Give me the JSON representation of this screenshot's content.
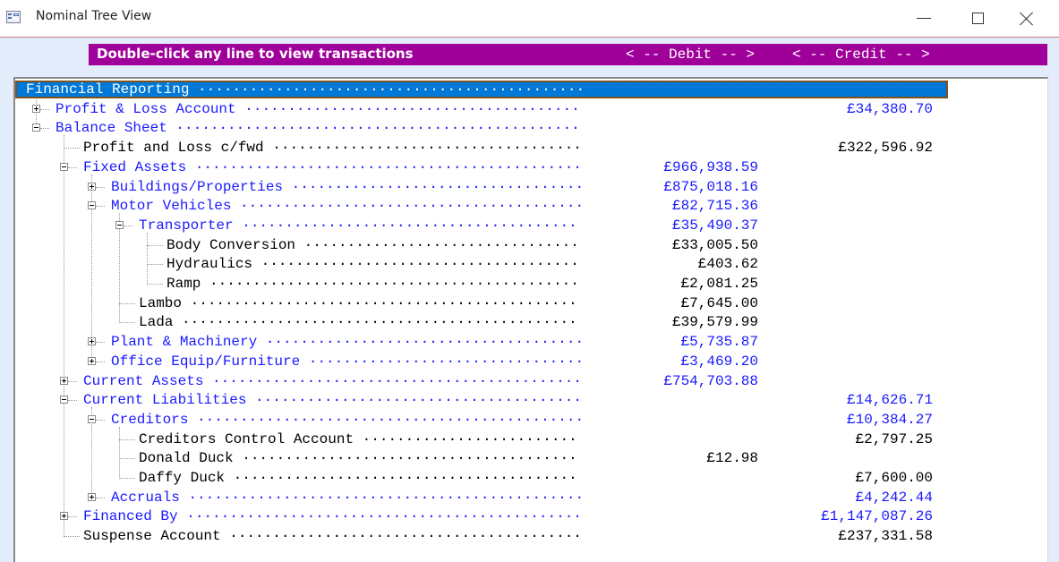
{
  "window": {
    "title": "Nominal Tree View",
    "icon": "form-icon",
    "controls": [
      "minimize-icon",
      "maximize-icon",
      "close-icon"
    ]
  },
  "header": {
    "instruction": "Double-click any line to view transactions",
    "debit_label": "< -- Debit -- >",
    "credit_label": "< -- Credit -- >",
    "color": "#a0009a"
  },
  "colors": {
    "group_text": "#1a1aff",
    "leaf_text": "#000000",
    "selection": "#0078d7"
  },
  "tree": [
    {
      "label": "Financial Reporting",
      "level": 0,
      "type": "root",
      "expander": "none",
      "debit": "",
      "credit": "",
      "selected": true
    },
    {
      "label": "Profit & Loss Account",
      "level": 1,
      "type": "group",
      "expander": "plus",
      "debit": "",
      "credit": "£34,380.70"
    },
    {
      "label": "Balance Sheet",
      "level": 1,
      "type": "group",
      "expander": "minus",
      "debit": "",
      "credit": ""
    },
    {
      "label": "Profit and Loss c/fwd",
      "level": 2,
      "type": "leaf",
      "expander": "none",
      "debit": "",
      "credit": "£322,596.92"
    },
    {
      "label": "Fixed Assets",
      "level": 2,
      "type": "group",
      "expander": "minus",
      "debit": "£966,938.59",
      "credit": ""
    },
    {
      "label": "Buildings/Properties",
      "level": 3,
      "type": "group",
      "expander": "plus",
      "debit": "£875,018.16",
      "credit": ""
    },
    {
      "label": "Motor Vehicles",
      "level": 3,
      "type": "group",
      "expander": "minus",
      "debit": "£82,715.36",
      "credit": ""
    },
    {
      "label": "Transporter",
      "level": 4,
      "type": "group",
      "expander": "minus",
      "debit": "£35,490.37",
      "credit": ""
    },
    {
      "label": "Body Conversion",
      "level": 5,
      "type": "leaf",
      "expander": "none",
      "debit": "£33,005.50",
      "credit": ""
    },
    {
      "label": "Hydraulics",
      "level": 5,
      "type": "leaf",
      "expander": "none",
      "debit": "£403.62",
      "credit": ""
    },
    {
      "label": "Ramp",
      "level": 5,
      "type": "leaf",
      "expander": "none",
      "debit": "£2,081.25",
      "credit": ""
    },
    {
      "label": "Lambo",
      "level": 4,
      "type": "leaf",
      "expander": "none",
      "debit": "£7,645.00",
      "credit": ""
    },
    {
      "label": "Lada",
      "level": 4,
      "type": "leaf",
      "expander": "none",
      "debit": "£39,579.99",
      "credit": ""
    },
    {
      "label": "Plant & Machinery",
      "level": 3,
      "type": "group",
      "expander": "plus",
      "debit": "£5,735.87",
      "credit": ""
    },
    {
      "label": "Office Equip/Furniture",
      "level": 3,
      "type": "group",
      "expander": "plus",
      "debit": "£3,469.20",
      "credit": ""
    },
    {
      "label": "Current Assets",
      "level": 2,
      "type": "group",
      "expander": "plus",
      "debit": "£754,703.88",
      "credit": ""
    },
    {
      "label": "Current Liabilities",
      "level": 2,
      "type": "group",
      "expander": "minus",
      "debit": "",
      "credit": "£14,626.71"
    },
    {
      "label": "Creditors",
      "level": 3,
      "type": "group",
      "expander": "minus",
      "debit": "",
      "credit": "£10,384.27"
    },
    {
      "label": "Creditors Control Account",
      "level": 4,
      "type": "leaf",
      "expander": "none",
      "debit": "",
      "credit": "£2,797.25"
    },
    {
      "label": "Donald Duck",
      "level": 4,
      "type": "leaf",
      "expander": "none",
      "debit": "£12.98",
      "credit": ""
    },
    {
      "label": "Daffy Duck",
      "level": 4,
      "type": "leaf",
      "expander": "none",
      "debit": "",
      "credit": "£7,600.00"
    },
    {
      "label": "Accruals",
      "level": 3,
      "type": "group",
      "expander": "plus",
      "debit": "",
      "credit": "£4,242.44"
    },
    {
      "label": "Financed By",
      "level": 2,
      "type": "group",
      "expander": "plus",
      "debit": "",
      "credit": "£1,147,087.26"
    },
    {
      "label": "Suspense Account",
      "level": 2,
      "type": "leaf",
      "expander": "none",
      "debit": "",
      "credit": "£237,331.58"
    }
  ]
}
